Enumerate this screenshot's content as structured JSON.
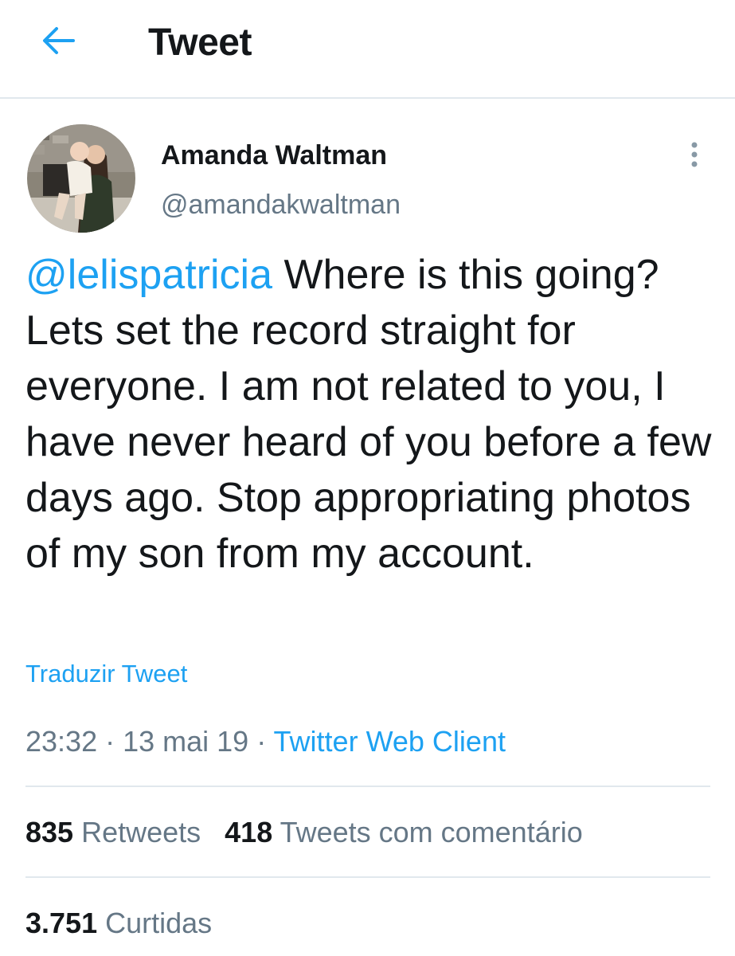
{
  "header": {
    "back_icon": "arrow-left-icon",
    "title": "Tweet",
    "accent_color": "#1da1f2"
  },
  "tweet": {
    "author": {
      "name": "Amanda Waltman",
      "handle": "@amandakwaltman",
      "avatar_icon": "profile-photo"
    },
    "more_icon": "more-vertical-icon",
    "mention": "@lelispatricia",
    "text": " Where is this going? Lets set the record straight for everyone. I am not related to you, I have never heard of you before a few days ago. Stop appropriating photos of my son from my account.",
    "translate_label": "Traduzir Tweet",
    "time": "23:32",
    "date": "13 mai 19",
    "separator": " · ",
    "client": "Twitter Web Client"
  },
  "stats": {
    "retweets_count": "835",
    "retweets_label": " Retweets",
    "quotes_count": "418",
    "quotes_label": " Tweets com comentário",
    "likes_count": "3.751",
    "likes_label": " Curtidas"
  },
  "colors": {
    "text": "#14171a",
    "secondary": "#657786",
    "divider": "#e1e8ed",
    "link": "#1da1f2"
  }
}
